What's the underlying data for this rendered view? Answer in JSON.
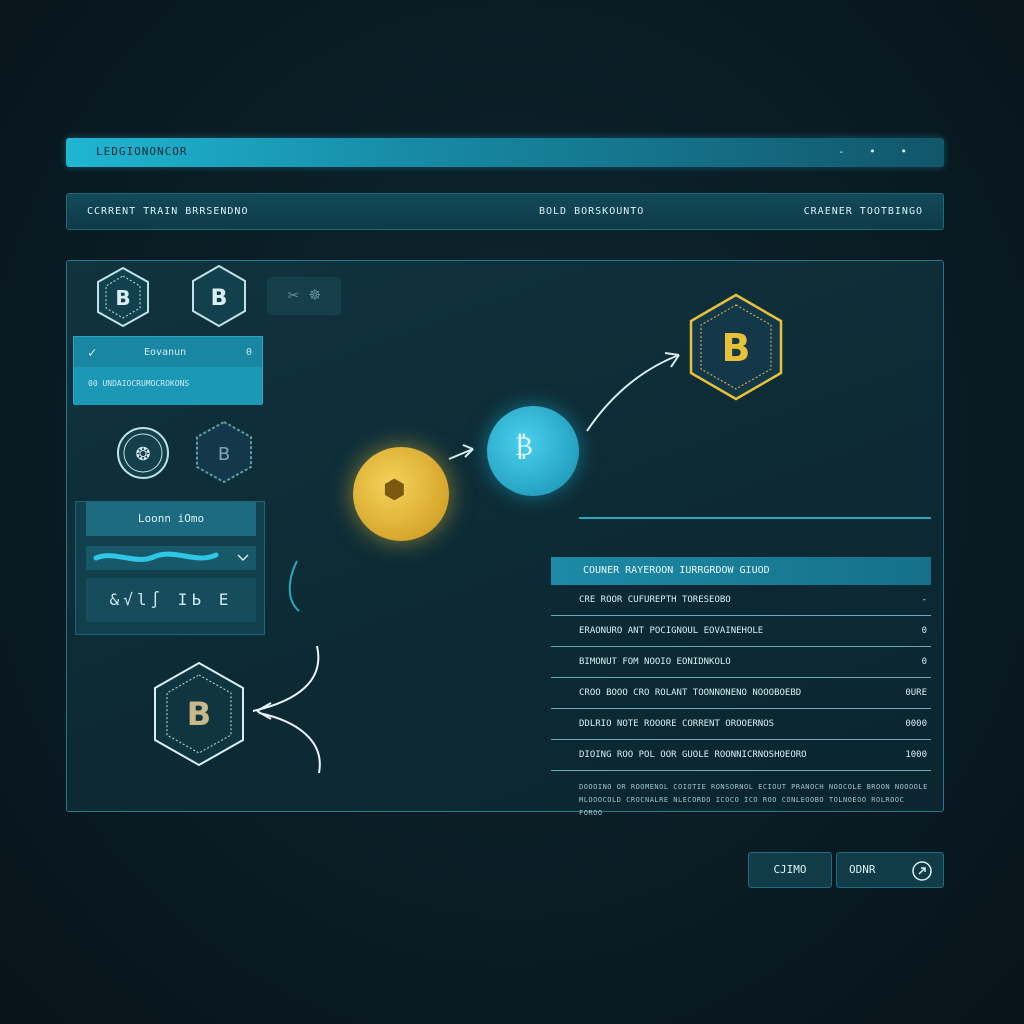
{
  "window": {
    "title": "LEDGIONONCOR",
    "controls": "- • •"
  },
  "header": {
    "left": "CCRRENT TRAIN BRRSENDNO",
    "center": "BOLD BORSKOUNTO",
    "right": "CRAENER TOOTBINGO"
  },
  "sidebar": {
    "menu_check": "✓",
    "menu_title": "Eovanun",
    "menu_count": "0",
    "menu_sub": "00 UNDAIOCRUMOCROKONS",
    "button_label": "Loonn iOmo",
    "stats": "&√l∫ IЬ E"
  },
  "details": {
    "header": "COUNER RAYEROON IURRGRDOW GIUOD",
    "rows": [
      {
        "label": "CRE ROOR CUFUREPTH TORESEOBO",
        "value": "-"
      },
      {
        "label": "ERAONURO ANT POCIGNOUL EOVAINEHOLE",
        "value": "0"
      },
      {
        "label": "BIMONUT FOM NOOIO EONIDNKOLO",
        "value": "0"
      },
      {
        "label": "CROO BOOO CRO ROLANT TOONNONENO NOOOBOEBD",
        "value": "0URE"
      },
      {
        "label": "DDLRIO NOTE ROOORE CORRENT OROOERNOS",
        "value": "0000"
      },
      {
        "label": "DIOING ROO POL OOR GUOLE ROONNICRNOSHOEORO",
        "value": "1000"
      }
    ],
    "note": "DOOOINO OR ROOMENOL COIOTIE RONSORNOL ECIOUT PRANOCH NOOCOLE BROON NOOOOLE MLOOOCOLD CROCNALRE NLECORDO ICOCO ICO ROO CONLEOOBO TOLNOEOO ROLROOC FOROO"
  },
  "footer": {
    "cancel_label": "CJIMO",
    "next_label": "ODNR"
  },
  "colors": {
    "accent": "#1fb6d3",
    "gold": "#e8c13a",
    "panel": "#0f3a47"
  }
}
